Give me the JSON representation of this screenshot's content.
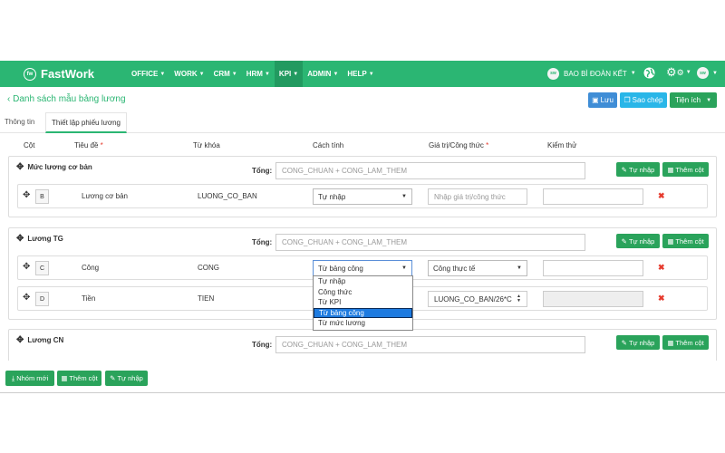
{
  "nav": {
    "logo_mark": "fw",
    "logo": "FastWork",
    "menu": [
      {
        "label": "OFFICE",
        "active": false
      },
      {
        "label": "WORK",
        "active": false
      },
      {
        "label": "CRM",
        "active": false
      },
      {
        "label": "HRM",
        "active": false
      },
      {
        "label": "KPI",
        "active": true
      },
      {
        "label": "ADMIN",
        "active": false
      },
      {
        "label": "HELP",
        "active": false
      }
    ],
    "company_badge": "sw",
    "company": "BAO BÌ ĐOÀN KẾT",
    "avatar_badge": "sw"
  },
  "toolbar": {
    "back": "‹ Danh sách mẫu bảng lương",
    "save": "Lưu",
    "copy": "Sao chép",
    "utilities": "Tiện ích",
    "colors": {
      "blue": "#3f8dd6",
      "cyan": "#29b6e8",
      "green": "#2aa35b"
    }
  },
  "tabs": [
    "Thông tin",
    "Thiết lập phiếu lương"
  ],
  "columns": {
    "col": "Cột",
    "title": "Tiêu đề",
    "required": "*",
    "keyword": "Từ khóa",
    "method": "Cách tính",
    "formula": "Giá trị/Công thức",
    "test": "Kiểm thử"
  },
  "groups": [
    {
      "title": "Mức lương cơ bản",
      "total_label": "Tổng:",
      "total": "CONG_CHUAN + CONG_LAM_THEM",
      "rows": [
        {
          "col": "B",
          "title": "Lương cơ bản",
          "key": "LUONG_CO_BAN",
          "method": "Tự nhập",
          "value": "",
          "placeholder": "Nhập giá trị/công thức",
          "test": ""
        }
      ]
    },
    {
      "title": "Lương TG",
      "total_label": "Tổng:",
      "total": "CONG_CHUAN + CONG_LAM_THEM",
      "rows": [
        {
          "col": "C",
          "title": "Công",
          "key": "CONG",
          "method": "Từ bảng công",
          "value": "Công thực tế",
          "test": ""
        },
        {
          "col": "D",
          "title": "Tiền",
          "key": "TIEN",
          "method": "Từ bảng công",
          "value": "LUONG_CO_BAN/26*C",
          "test": ""
        }
      ]
    },
    {
      "title": "Lương CN",
      "total_label": "Tổng:",
      "total": "CONG_CHUAN + CONG_LAM_THEM",
      "rows": []
    }
  ],
  "group_buttons": {
    "self_input": "Tự nhập",
    "add_column": "Thêm cột"
  },
  "dropdown": {
    "options": [
      "Tự nhập",
      "Công thức",
      "Từ KPI",
      "Từ bảng công",
      "Từ mức lương"
    ],
    "selected": "Từ bảng công"
  },
  "bottom": {
    "new_group": "Nhóm mới",
    "add_column": "Thêm cột",
    "self_input": "Tự nhập"
  }
}
